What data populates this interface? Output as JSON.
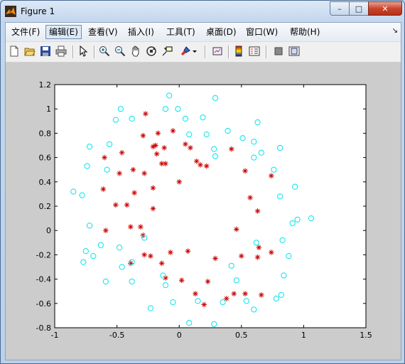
{
  "window": {
    "title": "Figure 1",
    "min_label": "–",
    "max_label": "□",
    "close_label": "✕"
  },
  "menu": [
    {
      "label": "文件(F)"
    },
    {
      "label": "编辑(E)"
    },
    {
      "label": "查看(V)"
    },
    {
      "label": "插入(I)"
    },
    {
      "label": "工具(T)"
    },
    {
      "label": "桌面(D)"
    },
    {
      "label": "窗口(W)"
    },
    {
      "label": "帮助(H)"
    }
  ],
  "toolbar": [
    "new-figure-icon",
    "open-file-icon",
    "save-icon",
    "print-icon",
    "edit-plot-arrow-icon",
    "zoom-in-icon",
    "zoom-out-icon",
    "pan-hand-icon",
    "rotate-3d-icon",
    "data-cursor-icon",
    "brush-icon",
    "link-plot-icon",
    "insert-colorbar-icon",
    "insert-legend-icon",
    "hide-plot-tools-icon",
    "show-plot-tools-icon"
  ],
  "colors": {
    "positive": "#cc0000",
    "negative": "#00e5ee",
    "figure_bg": "#cccccc"
  },
  "chart_data": {
    "type": "scatter",
    "xlim": [
      -1,
      1.5
    ],
    "ylim": [
      -0.8,
      1.2
    ],
    "xticks": [
      "-1",
      "-0.5",
      "0",
      "0.5",
      "1",
      "1.5"
    ],
    "yticks": [
      "-0.8",
      "-0.6",
      "-0.4",
      "-0.2",
      "0",
      "0.2",
      "0.4",
      "0.6",
      "0.8",
      "1",
      "1.2"
    ],
    "grid": false,
    "series": [
      {
        "marker": "+*",
        "color": "#cc0000",
        "points": [
          [
            -0.27,
            0.96
          ],
          [
            -0.17,
            0.8
          ],
          [
            -0.05,
            0.82
          ],
          [
            -0.29,
            0.78
          ],
          [
            -0.21,
            0.69
          ],
          [
            -0.19,
            0.7
          ],
          [
            -0.12,
            0.68
          ],
          [
            -0.18,
            0.63
          ],
          [
            -0.14,
            0.55
          ],
          [
            -0.11,
            0.55
          ],
          [
            -0.6,
            0.6
          ],
          [
            -0.46,
            0.64
          ],
          [
            -0.48,
            0.47
          ],
          [
            -0.37,
            0.5
          ],
          [
            -0.28,
            0.47
          ],
          [
            -0.61,
            0.34
          ],
          [
            -0.36,
            0.31
          ],
          [
            -0.21,
            0.35
          ],
          [
            0.05,
            0.71
          ],
          [
            0.09,
            0.68
          ],
          [
            0.14,
            0.57
          ],
          [
            0.17,
            0.54
          ],
          [
            0.22,
            0.53
          ],
          [
            0.42,
            0.67
          ],
          [
            0.53,
            0.49
          ],
          [
            0.74,
            0.45
          ],
          [
            0.57,
            0.27
          ],
          [
            0.63,
            0.16
          ],
          [
            -0.51,
            0.21
          ],
          [
            -0.42,
            0.21
          ],
          [
            -0.21,
            0.18
          ],
          [
            0.0,
            0.4
          ],
          [
            -0.39,
            0.03
          ],
          [
            -0.31,
            0.03
          ],
          [
            -0.29,
            -0.04
          ],
          [
            -0.59,
            0.0
          ],
          [
            0.46,
            0.01
          ],
          [
            0.64,
            -0.14
          ],
          [
            0.63,
            -0.22
          ],
          [
            0.74,
            -0.18
          ],
          [
            -0.28,
            -0.2
          ],
          [
            -0.23,
            -0.21
          ],
          [
            -0.07,
            -0.18
          ],
          [
            0.07,
            -0.17
          ],
          [
            0.29,
            -0.23
          ],
          [
            0.5,
            -0.21
          ],
          [
            -0.39,
            -0.27
          ],
          [
            -0.14,
            -0.27
          ],
          [
            -0.11,
            -0.39
          ],
          [
            0.02,
            -0.41
          ],
          [
            0.23,
            -0.42
          ],
          [
            0.13,
            -0.52
          ],
          [
            0.2,
            -0.61
          ],
          [
            0.38,
            -0.56
          ],
          [
            0.44,
            -0.52
          ],
          [
            0.53,
            -0.52
          ],
          [
            0.66,
            -0.53
          ]
        ]
      },
      {
        "marker": "o",
        "color": "#00e5ee",
        "points": [
          [
            -0.08,
            1.11
          ],
          [
            0.29,
            1.09
          ],
          [
            -0.47,
            1.0
          ],
          [
            -0.11,
            1.0
          ],
          [
            -0.01,
            1.0
          ],
          [
            -0.51,
            0.91
          ],
          [
            -0.38,
            0.92
          ],
          [
            0.05,
            0.92
          ],
          [
            0.19,
            0.93
          ],
          [
            0.63,
            0.89
          ],
          [
            0.08,
            0.79
          ],
          [
            0.22,
            0.79
          ],
          [
            0.39,
            0.82
          ],
          [
            0.51,
            0.76
          ],
          [
            -0.56,
            0.71
          ],
          [
            -0.72,
            0.69
          ],
          [
            0.28,
            0.67
          ],
          [
            0.6,
            0.73
          ],
          [
            0.66,
            0.64
          ],
          [
            0.81,
            0.68
          ],
          [
            -0.74,
            0.53
          ],
          [
            -0.58,
            0.5
          ],
          [
            0.29,
            0.61
          ],
          [
            0.6,
            0.6
          ],
          [
            0.76,
            0.5
          ],
          [
            -0.85,
            0.32
          ],
          [
            -0.78,
            0.29
          ],
          [
            0.81,
            0.28
          ],
          [
            0.93,
            0.36
          ],
          [
            -0.72,
            0.04
          ],
          [
            0.91,
            0.06
          ],
          [
            0.95,
            0.09
          ],
          [
            1.06,
            0.1
          ],
          [
            -0.28,
            -0.06
          ],
          [
            -0.63,
            -0.12
          ],
          [
            -0.75,
            -0.17
          ],
          [
            -0.48,
            -0.14
          ],
          [
            -0.69,
            -0.21
          ],
          [
            0.83,
            -0.08
          ],
          [
            0.62,
            -0.1
          ],
          [
            0.88,
            -0.21
          ],
          [
            -0.77,
            -0.26
          ],
          [
            -0.38,
            -0.26
          ],
          [
            -0.46,
            -0.3
          ],
          [
            0.42,
            -0.29
          ],
          [
            0.84,
            -0.37
          ],
          [
            -0.59,
            -0.42
          ],
          [
            -0.38,
            -0.42
          ],
          [
            -0.13,
            -0.37
          ],
          [
            -0.11,
            -0.45
          ],
          [
            -0.05,
            -0.59
          ],
          [
            0.15,
            -0.58
          ],
          [
            0.35,
            -0.59
          ],
          [
            0.46,
            -0.41
          ],
          [
            0.54,
            -0.58
          ],
          [
            0.78,
            -0.56
          ],
          [
            0.82,
            -0.53
          ],
          [
            -0.23,
            -0.64
          ],
          [
            0.08,
            -0.76
          ],
          [
            0.28,
            -0.77
          ],
          [
            0.6,
            -0.65
          ]
        ]
      }
    ]
  }
}
